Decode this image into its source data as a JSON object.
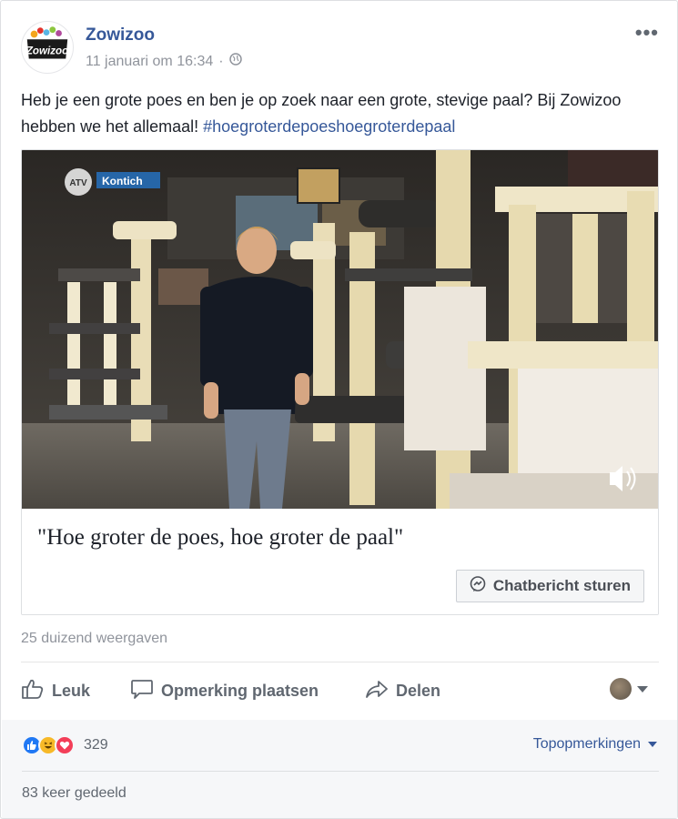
{
  "post": {
    "page_name": "Zowizoo",
    "timestamp": "11 januari om 16:34",
    "separator": "·",
    "visibility_icon": "globe-icon",
    "more_label": "•••",
    "text_main": "Heb je een grote poes en ben je op zoek naar een grote, stevige paal? Bij Zowizoo hebben we het allemaal! ",
    "hashtag": "#hoegroterdepoeshoegroterdepaal"
  },
  "logo": {
    "text": "Zowizoo"
  },
  "video": {
    "channel_logo": "ATV",
    "location_label": "Kontich",
    "sound_icon": "speaker-icon"
  },
  "link_card": {
    "caption": "\"Hoe groter de poes, hoe groter de paal\"",
    "chat_button_label": "Chatbericht sturen",
    "chat_icon": "messenger-icon"
  },
  "stats": {
    "views": "25 duizend weergaven",
    "reaction_count": "329",
    "reaction_types": [
      "like",
      "haha",
      "love"
    ],
    "top_comments_label": "Topopmerkingen",
    "shares": "83 keer gedeeld"
  },
  "actions": {
    "like_label": "Leuk",
    "comment_label": "Opmerking plaatsen",
    "share_label": "Delen"
  },
  "colors": {
    "link": "#365899",
    "like_blue": "#2078f4",
    "haha_yellow": "#f7b928",
    "love_red": "#f33e58"
  }
}
